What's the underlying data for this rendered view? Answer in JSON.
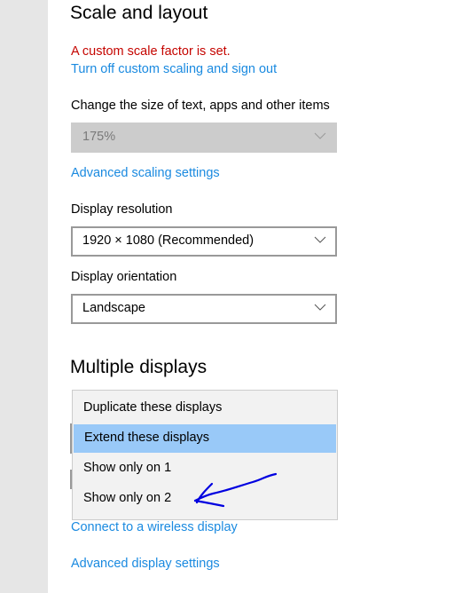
{
  "scale_section": {
    "title": "Scale and layout",
    "warning": "A custom scale factor is set.",
    "turn_off_link": "Turn off custom scaling and sign out",
    "size_label": "Change the size of text, apps and other items",
    "size_value": "175%",
    "advanced_scaling_link": "Advanced scaling settings",
    "resolution_label": "Display resolution",
    "resolution_value": "1920 × 1080 (Recommended)",
    "orientation_label": "Display orientation",
    "orientation_value": "Landscape"
  },
  "multiple_displays": {
    "title": "Multiple displays",
    "options": [
      {
        "label": "Duplicate these displays",
        "selected": false
      },
      {
        "label": "Extend these displays",
        "selected": true
      },
      {
        "label": "Show only on 1",
        "selected": false
      },
      {
        "label": "Show only on 2",
        "selected": false
      }
    ],
    "wireless_link": "Connect to a wireless display",
    "advanced_display_link": "Advanced display settings"
  },
  "annotation": {
    "type": "hand-drawn-arrow",
    "points_to": "Show only on 2",
    "color": "#0000e0"
  },
  "colors": {
    "link": "#1a8ae0",
    "warning": "#c50500",
    "selected_option": "#99c9f8",
    "sidebar": "#e6e6e6"
  }
}
